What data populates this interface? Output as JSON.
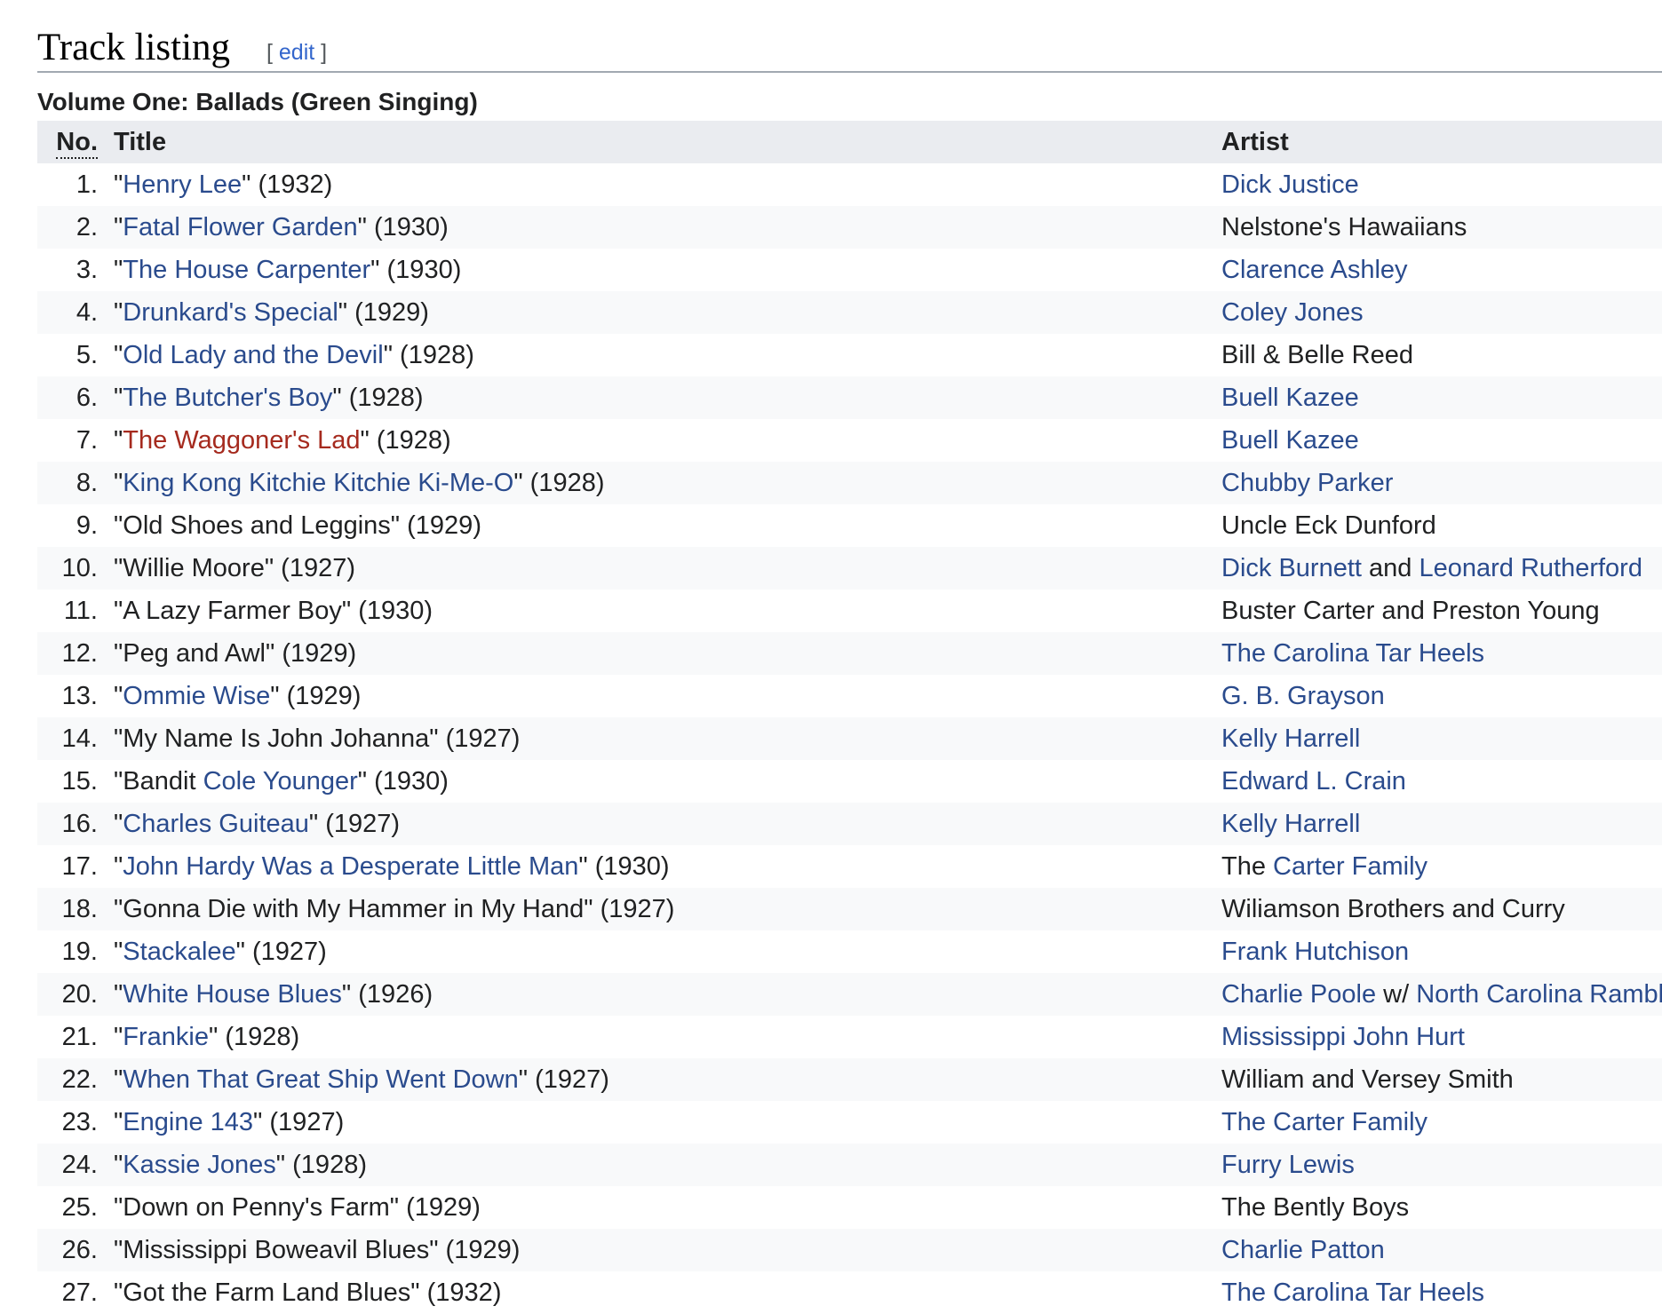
{
  "section": {
    "title": "Track listing",
    "edit_open": "[ ",
    "edit_label": "edit",
    "edit_close": " ]"
  },
  "table": {
    "caption": "Volume One: Ballads (Green Singing)",
    "headers": {
      "no": "No.",
      "title": "Title",
      "artist": "Artist"
    },
    "rows": [
      {
        "no": "1.",
        "title": [
          {
            "t": "\""
          },
          {
            "t": "Henry Lee",
            "link": "blue"
          },
          {
            "t": "\" (1932)"
          }
        ],
        "artist": [
          {
            "t": "Dick Justice",
            "link": "blue"
          }
        ]
      },
      {
        "no": "2.",
        "title": [
          {
            "t": "\""
          },
          {
            "t": "Fatal Flower Garden",
            "link": "blue"
          },
          {
            "t": "\" (1930)"
          }
        ],
        "artist": [
          {
            "t": "Nelstone's Hawaiians"
          }
        ]
      },
      {
        "no": "3.",
        "title": [
          {
            "t": "\""
          },
          {
            "t": "The House Carpenter",
            "link": "blue"
          },
          {
            "t": "\" (1930)"
          }
        ],
        "artist": [
          {
            "t": "Clarence Ashley",
            "link": "blue"
          }
        ]
      },
      {
        "no": "4.",
        "title": [
          {
            "t": "\""
          },
          {
            "t": "Drunkard's Special",
            "link": "blue"
          },
          {
            "t": "\" (1929)"
          }
        ],
        "artist": [
          {
            "t": "Coley Jones",
            "link": "blue"
          }
        ]
      },
      {
        "no": "5.",
        "title": [
          {
            "t": "\""
          },
          {
            "t": "Old Lady and the Devil",
            "link": "blue"
          },
          {
            "t": "\" (1928)"
          }
        ],
        "artist": [
          {
            "t": "Bill & Belle Reed"
          }
        ]
      },
      {
        "no": "6.",
        "title": [
          {
            "t": "\""
          },
          {
            "t": "The Butcher's Boy",
            "link": "blue"
          },
          {
            "t": "\" (1928)"
          }
        ],
        "artist": [
          {
            "t": "Buell Kazee",
            "link": "blue"
          }
        ]
      },
      {
        "no": "7.",
        "title": [
          {
            "t": "\""
          },
          {
            "t": "The Waggoner's Lad",
            "link": "red"
          },
          {
            "t": "\" (1928)"
          }
        ],
        "artist": [
          {
            "t": "Buell Kazee",
            "link": "blue"
          }
        ]
      },
      {
        "no": "8.",
        "title": [
          {
            "t": "\""
          },
          {
            "t": "King Kong Kitchie Kitchie Ki-Me-O",
            "link": "blue"
          },
          {
            "t": "\" (1928)"
          }
        ],
        "artist": [
          {
            "t": "Chubby Parker",
            "link": "blue"
          }
        ]
      },
      {
        "no": "9.",
        "title": [
          {
            "t": "\"Old Shoes and Leggins\" (1929)"
          }
        ],
        "artist": [
          {
            "t": "Uncle Eck Dunford"
          }
        ]
      },
      {
        "no": "10.",
        "title": [
          {
            "t": "\"Willie Moore\" (1927)"
          }
        ],
        "artist": [
          {
            "t": "Dick Burnett",
            "link": "blue"
          },
          {
            "t": " and "
          },
          {
            "t": "Leonard Rutherford",
            "link": "blue"
          }
        ]
      },
      {
        "no": "11.",
        "title": [
          {
            "t": "\"A Lazy Farmer Boy\" (1930)"
          }
        ],
        "artist": [
          {
            "t": "Buster Carter and Preston Young"
          }
        ]
      },
      {
        "no": "12.",
        "title": [
          {
            "t": "\"Peg and Awl\" (1929)"
          }
        ],
        "artist": [
          {
            "t": "The Carolina Tar Heels",
            "link": "blue"
          }
        ]
      },
      {
        "no": "13.",
        "title": [
          {
            "t": "\""
          },
          {
            "t": "Ommie Wise",
            "link": "blue"
          },
          {
            "t": "\" (1929)"
          }
        ],
        "artist": [
          {
            "t": "G. B. Grayson",
            "link": "blue"
          }
        ]
      },
      {
        "no": "14.",
        "title": [
          {
            "t": "\"My Name Is John Johanna\" (1927)"
          }
        ],
        "artist": [
          {
            "t": "Kelly Harrell",
            "link": "blue"
          }
        ]
      },
      {
        "no": "15.",
        "title": [
          {
            "t": "\"Bandit "
          },
          {
            "t": "Cole Younger",
            "link": "blue"
          },
          {
            "t": "\" (1930)"
          }
        ],
        "artist": [
          {
            "t": "Edward L. Crain",
            "link": "blue"
          }
        ]
      },
      {
        "no": "16.",
        "title": [
          {
            "t": "\""
          },
          {
            "t": "Charles Guiteau",
            "link": "blue"
          },
          {
            "t": "\" (1927)"
          }
        ],
        "artist": [
          {
            "t": "Kelly Harrell",
            "link": "blue"
          }
        ]
      },
      {
        "no": "17.",
        "title": [
          {
            "t": "\""
          },
          {
            "t": "John Hardy Was a Desperate Little Man",
            "link": "blue"
          },
          {
            "t": "\" (1930)"
          }
        ],
        "artist": [
          {
            "t": "The "
          },
          {
            "t": "Carter Family",
            "link": "blue"
          }
        ]
      },
      {
        "no": "18.",
        "title": [
          {
            "t": "\"Gonna Die with My Hammer in My Hand\" (1927)"
          }
        ],
        "artist": [
          {
            "t": "Wiliamson Brothers and Curry"
          }
        ]
      },
      {
        "no": "19.",
        "title": [
          {
            "t": "\""
          },
          {
            "t": "Stackalee",
            "link": "blue"
          },
          {
            "t": "\" (1927)"
          }
        ],
        "artist": [
          {
            "t": "Frank Hutchison",
            "link": "blue"
          }
        ]
      },
      {
        "no": "20.",
        "title": [
          {
            "t": "\""
          },
          {
            "t": "White House Blues",
            "link": "blue"
          },
          {
            "t": "\" (1926)"
          }
        ],
        "artist": [
          {
            "t": "Charlie Poole",
            "link": "blue"
          },
          {
            "t": " w/ "
          },
          {
            "t": "North Carolina Ramble",
            "link": "blue"
          }
        ]
      },
      {
        "no": "21.",
        "title": [
          {
            "t": "\""
          },
          {
            "t": "Frankie",
            "link": "blue"
          },
          {
            "t": "\" (1928)"
          }
        ],
        "artist": [
          {
            "t": "Mississippi John Hurt",
            "link": "blue"
          }
        ]
      },
      {
        "no": "22.",
        "title": [
          {
            "t": "\""
          },
          {
            "t": "When That Great Ship Went Down",
            "link": "blue"
          },
          {
            "t": "\" (1927)"
          }
        ],
        "artist": [
          {
            "t": "William and Versey Smith"
          }
        ]
      },
      {
        "no": "23.",
        "title": [
          {
            "t": "\""
          },
          {
            "t": "Engine 143",
            "link": "blue"
          },
          {
            "t": "\" (1927)"
          }
        ],
        "artist": [
          {
            "t": "The Carter Family",
            "link": "blue"
          }
        ]
      },
      {
        "no": "24.",
        "title": [
          {
            "t": "\""
          },
          {
            "t": "Kassie Jones",
            "link": "blue"
          },
          {
            "t": "\" (1928)"
          }
        ],
        "artist": [
          {
            "t": "Furry Lewis",
            "link": "blue"
          }
        ]
      },
      {
        "no": "25.",
        "title": [
          {
            "t": "\"Down on Penny's Farm\" (1929)"
          }
        ],
        "artist": [
          {
            "t": "The Bently Boys"
          }
        ]
      },
      {
        "no": "26.",
        "title": [
          {
            "t": "\"Mississippi Boweavil Blues\" (1929)"
          }
        ],
        "artist": [
          {
            "t": "Charlie Patton",
            "link": "blue"
          }
        ]
      },
      {
        "no": "27.",
        "title": [
          {
            "t": "\"Got the Farm Land Blues\" (1932)"
          }
        ],
        "artist": [
          {
            "t": "The Carolina Tar Heels",
            "link": "blue"
          }
        ]
      }
    ]
  },
  "colors": {
    "link": "#2a4b8d",
    "redlink": "#a52a1e",
    "text": "#202122",
    "header_bg": "#eaecf0",
    "alt_row_bg": "#f8f9fa",
    "heading_rule": "#a2a9b1"
  }
}
